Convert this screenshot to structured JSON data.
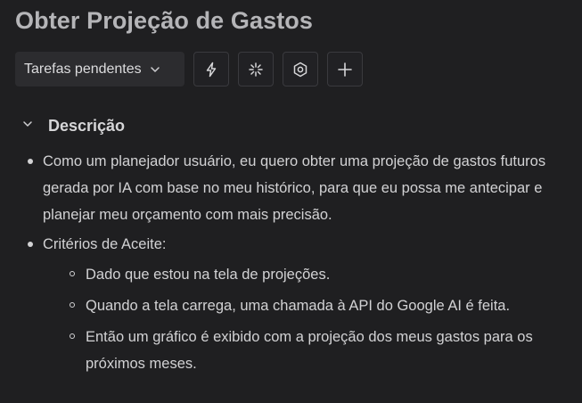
{
  "title": "Obter Projeção de Gastos",
  "toolbar": {
    "status_label": "Tarefas pendentes",
    "status_icon": "chevron-down-icon",
    "buttons": [
      {
        "icon": "lightning-icon"
      },
      {
        "icon": "sparkle-icon"
      },
      {
        "icon": "hexagon-settings-icon"
      },
      {
        "icon": "plus-icon"
      }
    ]
  },
  "description": {
    "header": "Descrição",
    "items": [
      {
        "text": "Como um planejador usuário, eu quero obter uma projeção de gastos futuros gerada por IA com base no meu histórico, para que eu possa me antecipar e planejar meu orçamento com mais precisão."
      },
      {
        "text": "Critérios de Aceite:",
        "subitems": [
          "Dado que estou na tela de projeções.",
          "Quando a tela carrega, uma chamada à API do Google AI é feita.",
          "Então um gráfico é exibido com a projeção dos meus gastos para os próximos meses."
        ]
      }
    ]
  },
  "colors": {
    "background": "#1f1f21",
    "title": "#b5b5b8",
    "text": "#d2d2d4",
    "button_border": "#3a3a3e",
    "select_bg": "#2c2c2f"
  }
}
